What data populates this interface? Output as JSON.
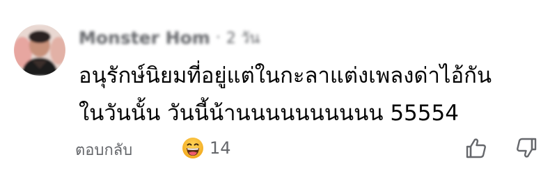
{
  "comment": {
    "author": "Monster Hom",
    "separator": "·",
    "time": "2 วัน",
    "text_lines": [
      "อนุรักษ์นิยมที่อยู่แต่ในกะลาแต่งเพลงด่าไอ้กัน",
      "ในวันนั้น วันนี้น้านนนนนนนนนน 55554"
    ],
    "reply_label": "ตอบกลับ",
    "reaction": {
      "icon": "haha-emoji-icon",
      "count": "14"
    },
    "actions": {
      "upvote_icon": "thumbs-up-icon",
      "downvote_icon": "thumbs-down-icon"
    }
  },
  "colors": {
    "text_primary": "#050505",
    "text_secondary": "#65676b",
    "emoji_yellow": "#f7b125",
    "background": "#ffffff"
  }
}
